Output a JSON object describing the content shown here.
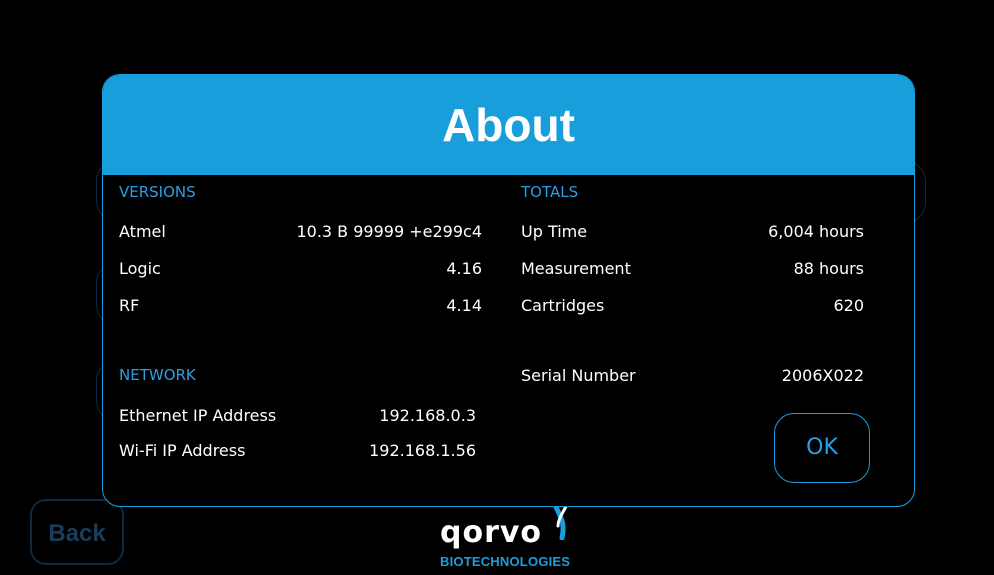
{
  "background": {
    "back_button_label": "Back"
  },
  "logo": {
    "wordmark": "qorvo",
    "subtitle": "BIOTECHNOLOGIES"
  },
  "dialog": {
    "title": "About",
    "versions": {
      "heading": "VERSIONS",
      "rows": [
        {
          "label": "Atmel",
          "value": "10.3 B 99999 +e299c4"
        },
        {
          "label": "Logic",
          "value": "4.16"
        },
        {
          "label": "RF",
          "value": "4.14"
        }
      ]
    },
    "network": {
      "heading": "NETWORK",
      "rows": [
        {
          "label": "Ethernet IP Address",
          "value": "192.168.0.3"
        },
        {
          "label": "Wi-Fi IP Address",
          "value": "192.168.1.56"
        }
      ]
    },
    "totals": {
      "heading": "TOTALS",
      "rows": [
        {
          "label": "Up Time",
          "value": "6,004 hours"
        },
        {
          "label": "Measurement",
          "value": "88 hours"
        },
        {
          "label": "Cartridges",
          "value": "620"
        }
      ]
    },
    "serial": {
      "label": "Serial Number",
      "value": "2006X022"
    },
    "ok_label": "OK"
  },
  "colors": {
    "accent": "#189fdb",
    "background": "#000000",
    "text": "#ffffff"
  }
}
